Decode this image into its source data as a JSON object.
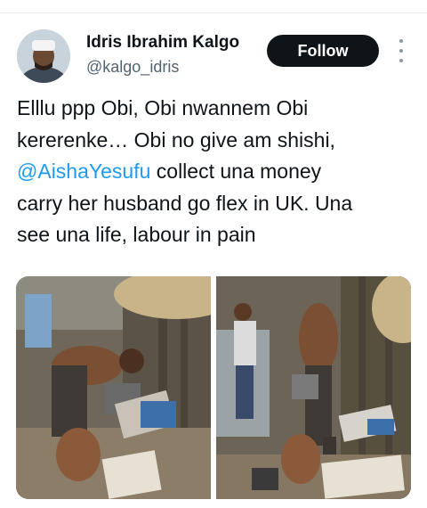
{
  "author": {
    "name": "Idris Ibrahim Kalgo",
    "handle": "@kalgo_idris"
  },
  "follow_label": "Follow",
  "more_icon": "more-vertical-icon",
  "tweet": {
    "line1": "Elllu ppp Obi, Obi nwannem Obi",
    "line2": "kererenke… Obi no give am shishi,",
    "line3_mention": "@AishaYesufu",
    "line3_rest": " collect una money",
    "line4": "carry her husband go flex in UK. Una",
    "line5": "see una life, labour in pain"
  },
  "colors": {
    "accent": "#1d9bf0",
    "follow_bg": "#0f1419",
    "text": "#0f1419",
    "secondary": "#536471"
  }
}
